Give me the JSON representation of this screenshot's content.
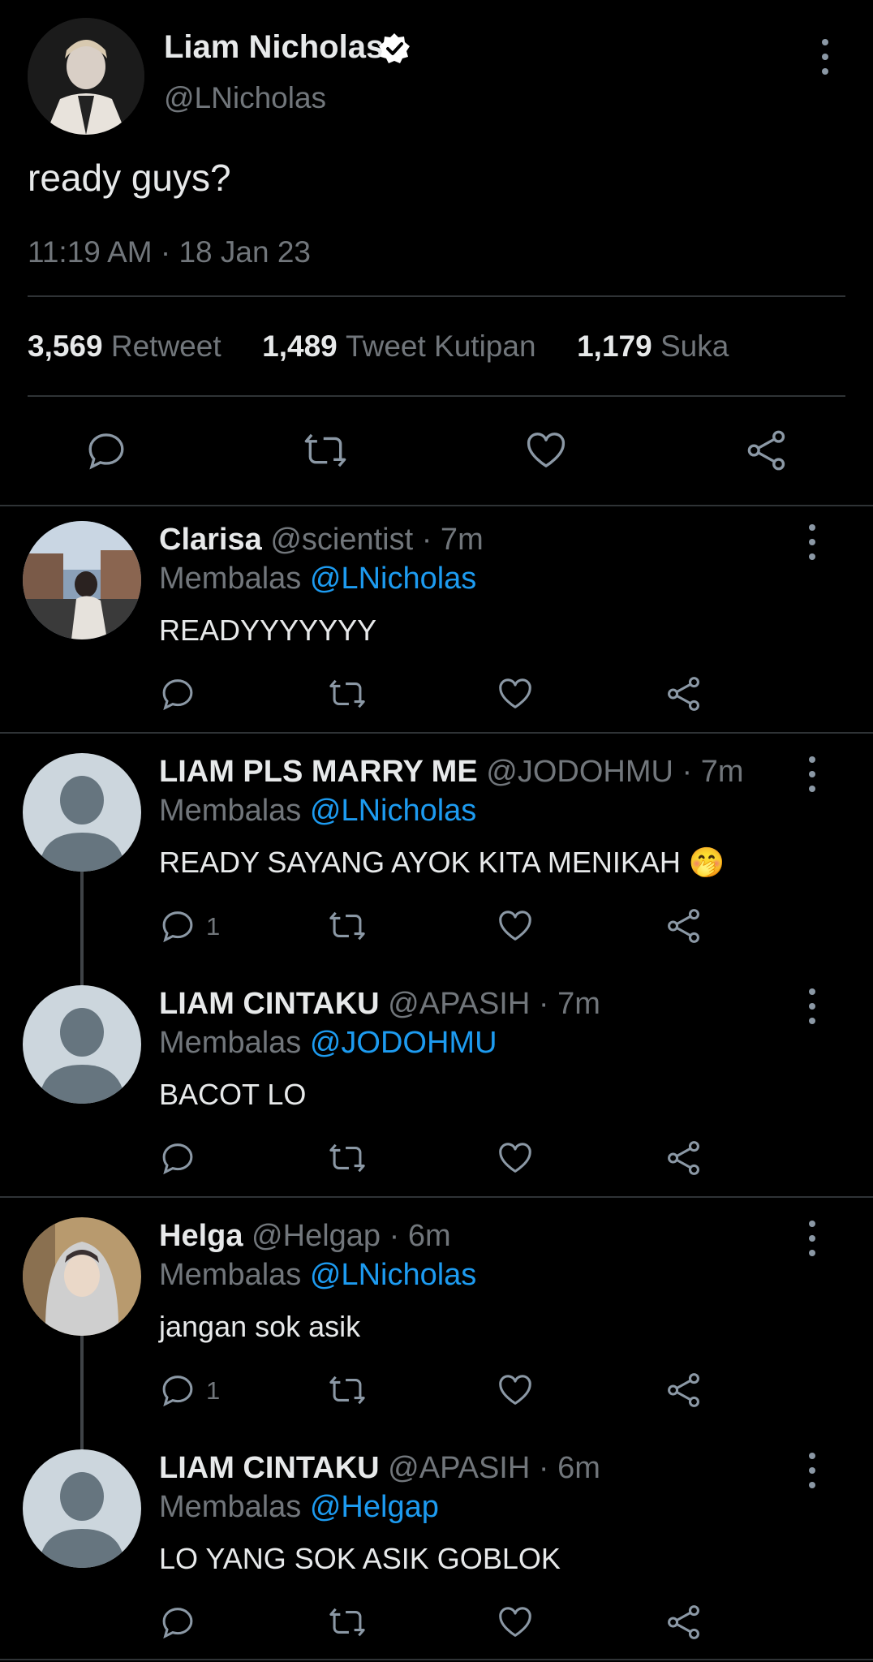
{
  "tweet": {
    "author_name": "Liam Nicholas",
    "author_handle": "@LNicholas",
    "text": "ready guys?",
    "timestamp": "11:19 AM · 18 Jan 23",
    "stats": [
      {
        "count": "3,569",
        "label": "Retweet"
      },
      {
        "count": "1,489",
        "label": "Tweet Kutipan"
      },
      {
        "count": "1,179",
        "label": "Suka"
      }
    ]
  },
  "replies": [
    {
      "name": "Clarisa",
      "handle": "@scientist",
      "time": "· 7m",
      "replying_prefix": "Membalas",
      "replying_to": "@LNicholas",
      "text": "READYYYYYYY",
      "reply_count": ""
    },
    {
      "name": "LIAM PLS MARRY ME",
      "handle": "@JODOHMU",
      "time": "· 7m",
      "replying_prefix": "Membalas",
      "replying_to": "@LNicholas",
      "text": "READY SAYANG AYOK KITA MENIKAH 🤭",
      "reply_count": "1"
    },
    {
      "name": "LIAM CINTAKU",
      "handle": "@APASIH",
      "time": "· 7m",
      "replying_prefix": "Membalas",
      "replying_to": "@JODOHMU",
      "text": "BACOT LO",
      "reply_count": ""
    },
    {
      "name": "Helga",
      "handle": "@Helgap",
      "time": "· 6m",
      "replying_prefix": "Membalas",
      "replying_to": "@LNicholas",
      "text": "jangan sok asik",
      "reply_count": "1"
    },
    {
      "name": "LIAM CINTAKU",
      "handle": "@APASIH",
      "time": "· 6m",
      "replying_prefix": "Membalas",
      "replying_to": "@Helgap",
      "text": "LO YANG SOK ASIK GOBLOK",
      "reply_count": ""
    }
  ],
  "colors": {
    "background": "#000000",
    "accent": "#1d9bf0",
    "muted": "#71767b",
    "divider": "#2f3336"
  },
  "icons": [
    "verified-badge-icon",
    "more-icon",
    "reply-icon",
    "retweet-icon",
    "like-icon",
    "share-icon"
  ]
}
